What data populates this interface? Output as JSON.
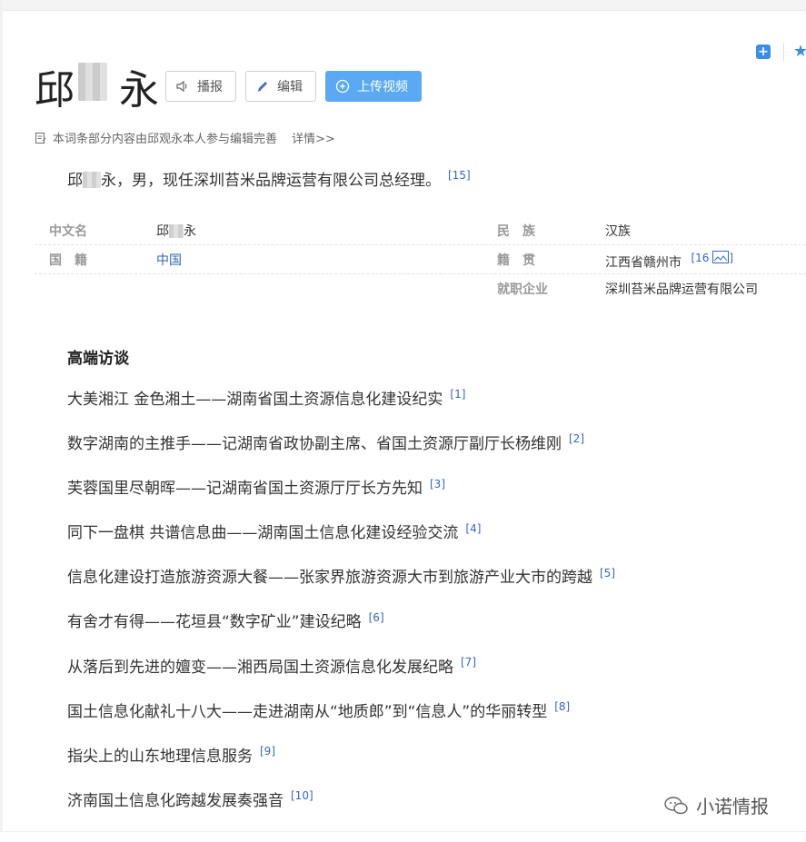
{
  "header": {
    "title_first": "邱",
    "title_last": "永",
    "buttons": {
      "broadcast": "播报",
      "edit": "编辑",
      "upload_video": "上传视频"
    }
  },
  "notice": {
    "text": "本词条部分内容由邱观永本人参与编辑完善",
    "detail_link": "详情>>"
  },
  "summary": {
    "name_first": "邱",
    "name_last": "永",
    "text": "，男，现任深圳苔米品牌运营有限公司总经理。",
    "ref": "[15]"
  },
  "info_box": {
    "rows": [
      {
        "k1": "中文名",
        "v1_first": "邱",
        "v1_last": "永",
        "k2": "民　族",
        "v2": "汉族"
      },
      {
        "k1": "国　籍",
        "v1": "中国",
        "k2": "籍　贯",
        "v2": "江西省赣州市",
        "v2_ref_open": "[16",
        "v2_ref_close": "]"
      },
      {
        "k2": "就职企业",
        "v2": "深圳苔米品牌运营有限公司"
      }
    ]
  },
  "section": {
    "title": "高端访谈"
  },
  "interviews": [
    {
      "text": "大美湘江 金色湘土——湖南省国土资源信息化建设纪实",
      "ref": "[1]"
    },
    {
      "text": "数字湖南的主推手——记湖南省政协副主席、省国土资源厅副厅长杨维刚",
      "ref": "[2]"
    },
    {
      "text": "芙蓉国里尽朝晖——记湖南省国土资源厅厅长方先知",
      "ref": "[3]"
    },
    {
      "text": "同下一盘棋 共谱信息曲——湖南国土信息化建设经验交流",
      "ref": "[4]"
    },
    {
      "text": "信息化建设打造旅游资源大餐——张家界旅游资源大市到旅游产业大市的跨越",
      "ref": "[5]"
    },
    {
      "text": "有舍才有得——花垣县“数字矿业”建设纪略",
      "ref": "[6]"
    },
    {
      "text": "从落后到先进的嬗变——湘西局国土资源信息化发展纪略",
      "ref": "[7]"
    },
    {
      "text": "国土信息化献礼十八大——走进湖南从“地质郎”到“信息人”的华丽转型",
      "ref": "[8]"
    },
    {
      "text": "指尖上的山东地理信息服务",
      "ref": "[9]"
    },
    {
      "text": "济南国土信息化跨越发展奏强音",
      "ref": "[10]"
    }
  ],
  "watermark": {
    "text": "小诺情报"
  },
  "icons": {
    "broadcast": "speaker-icon",
    "edit": "pencil-icon",
    "upload": "plus-circle-icon",
    "notice": "document-edit-icon",
    "add": "plus-square-icon",
    "favorite": "star-icon",
    "image": "image-icon",
    "watermark": "wechat-icon"
  },
  "colors": {
    "accent": "#3a8ee6",
    "upload_button": "#5aa9f5",
    "link": "#3366cc"
  }
}
